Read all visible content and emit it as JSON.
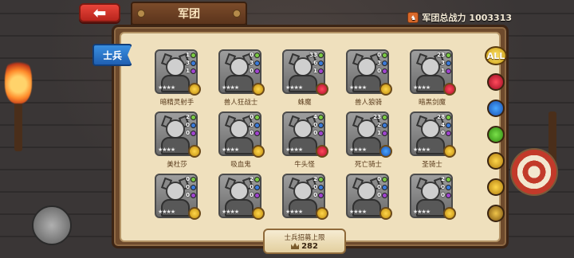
{
  "header": {
    "back_icon": "back-arrow-icon",
    "title": "军团",
    "power_label": "军团总战力",
    "power_value": "1003313"
  },
  "tab": {
    "label": "士兵"
  },
  "filters": {
    "all_label": "ALL",
    "items": [
      "red-element-icon",
      "blue-element-icon",
      "green-element-icon",
      "gold-element-icon",
      "gold-element-icon",
      "dark-element-icon"
    ]
  },
  "units": [
    {
      "name": "暗精灵射手",
      "stats": [
        "1",
        "3",
        "1"
      ],
      "element": "gold"
    },
    {
      "name": "兽人狂战士",
      "stats": [
        "0",
        "3",
        "0"
      ],
      "element": "gold"
    },
    {
      "name": "蛛魔",
      "stats": [
        "33",
        "6",
        "1"
      ],
      "element": "red"
    },
    {
      "name": "兽人狼骑",
      "stats": [
        "0",
        "3",
        "0"
      ],
      "element": "gold"
    },
    {
      "name": "暗黑剑魔",
      "stats": [
        "23",
        "3",
        "1"
      ],
      "element": "red"
    },
    {
      "name": "美杜莎",
      "stats": [
        "2",
        "0",
        "0"
      ],
      "element": "gold"
    },
    {
      "name": "吸血鬼",
      "stats": [
        "0",
        "0",
        "0"
      ],
      "element": "gold"
    },
    {
      "name": "牛头怪",
      "stats": [
        "4",
        "0",
        "0"
      ],
      "element": "red"
    },
    {
      "name": "死亡骑士",
      "stats": [
        "23",
        "2",
        "1"
      ],
      "element": "blue"
    },
    {
      "name": "圣骑士",
      "stats": [
        "28",
        "4",
        "0"
      ],
      "element": "gold"
    },
    {
      "name": "",
      "stats": [
        "0",
        "0",
        "0"
      ],
      "element": "gold"
    },
    {
      "name": "",
      "stats": [
        "2",
        "0",
        "0"
      ],
      "element": "gold"
    },
    {
      "name": "",
      "stats": [
        "2",
        "0",
        "0"
      ],
      "element": "gold"
    },
    {
      "name": "",
      "stats": [
        "0",
        "0",
        "0"
      ],
      "element": "gold"
    },
    {
      "name": "",
      "stats": [
        "2",
        "0",
        "0"
      ],
      "element": "gold"
    }
  ],
  "recruit": {
    "label": "士兵招募上限",
    "count": "282"
  },
  "card_stars": "★★★★"
}
